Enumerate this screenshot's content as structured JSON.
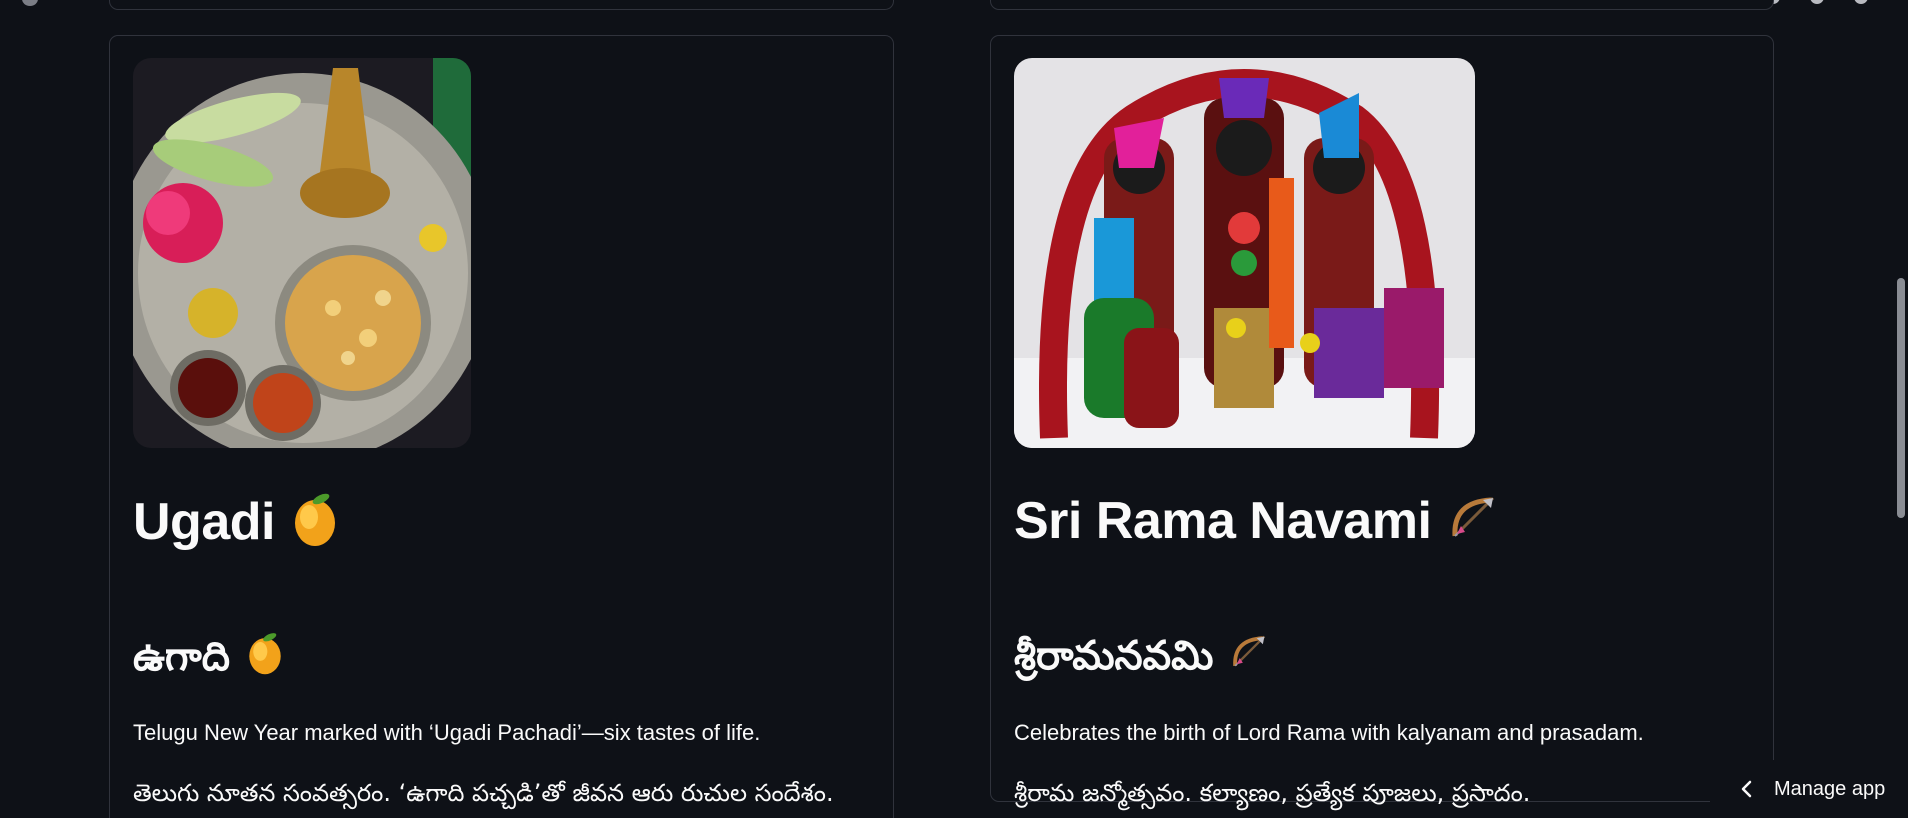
{
  "cards": {
    "ugadi": {
      "title": "Ugadi",
      "title_emoji": "mango-emoji",
      "subtitle": "ఉగాది",
      "subtitle_emoji": "mango-emoji",
      "desc_en": "Telugu New Year marked with ‘Ugadi Pachadi’—six tastes of life.",
      "desc_te": "తెలుగు నూతన సంవత్సరం. ‘ఉగాది పచ్చడి’తో జీవన ఆరు రుచుల సందేశం.",
      "image_alt": "ugadi-pachadi-plate-photo"
    },
    "rama": {
      "title": "Sri Rama Navami",
      "title_emoji": "bow-and-arrow-emoji",
      "subtitle": "శ్రీరామనవమి",
      "subtitle_emoji": "bow-and-arrow-emoji",
      "desc_en": "Celebrates the birth of Lord Rama with kalyanam and prasadam.",
      "desc_te": "శ్రీరామ జన్మోత్సవం. కల్యాణం, ప్రత్యేక పూజలు, ప్రసాదం.",
      "image_alt": "rama-sita-lakshmana-idols-photo"
    }
  },
  "manage_app": {
    "label": "Manage app",
    "icon": "chevron-left-icon"
  },
  "colors": {
    "background": "#0e1117",
    "card_border": "#30333c",
    "text": "#fafafa"
  }
}
